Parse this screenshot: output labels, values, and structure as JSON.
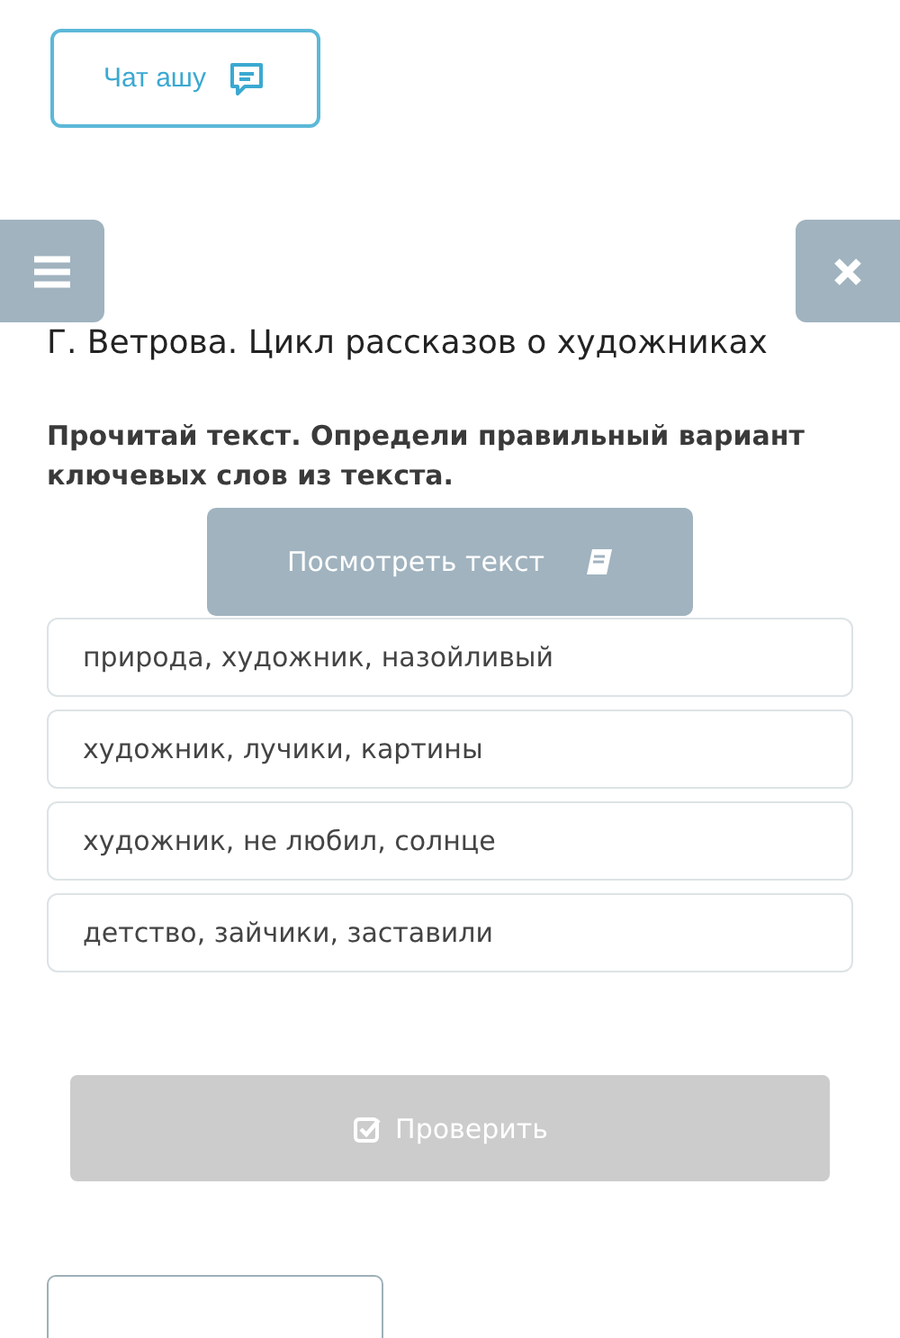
{
  "chat_button": {
    "label": "Чат ашу"
  },
  "title": "Г. Ветрова. Цикл рассказов о художниках",
  "instruction": "Прочитай текст. Определи правильный вариант ключевых слов из текста.",
  "view_text_button": {
    "label": "Посмотреть текст"
  },
  "options": [
    {
      "label": "природа, художник, назойливый",
      "selected": false
    },
    {
      "label": "художник, лучики, картины",
      "selected": false
    },
    {
      "label": "художник, не любил, солнце",
      "selected": false
    },
    {
      "label": "детство, зайчики, заставили",
      "selected": false
    }
  ],
  "check_button": {
    "label": "Проверить",
    "disabled": true
  }
}
